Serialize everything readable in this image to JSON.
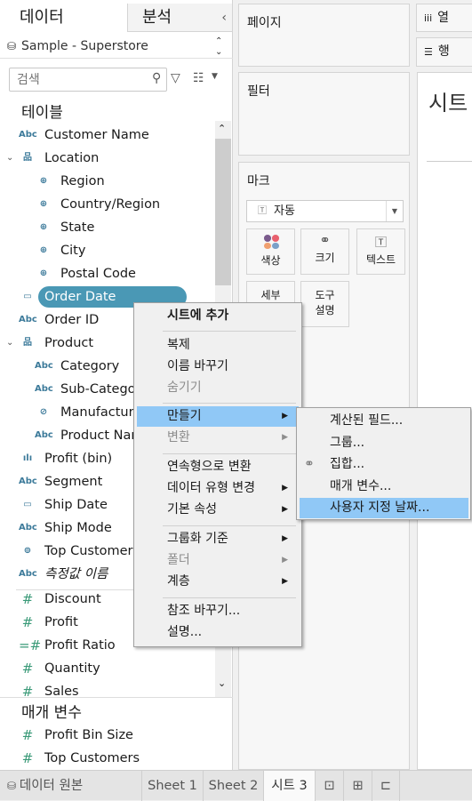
{
  "data_pane": {
    "tab_data": "데이터",
    "tab_analysis": "분석",
    "collapse_icon": "chevron-left-icon",
    "datasource": "Sample - Superstore",
    "search_placeholder": "검색",
    "tables_header": "테이블",
    "fields": [
      {
        "label": "Customer Name",
        "icon": "Abc"
      },
      {
        "label": "Location",
        "icon": "hierarchy",
        "expanded": true
      },
      {
        "label": "Region",
        "icon": "globe"
      },
      {
        "label": "Country/Region",
        "icon": "globe"
      },
      {
        "label": "State",
        "icon": "globe"
      },
      {
        "label": "City",
        "icon": "globe"
      },
      {
        "label": "Postal Code",
        "icon": "globe"
      },
      {
        "label": "Order Date",
        "icon": "calendar",
        "selected": true
      },
      {
        "label": "Order ID",
        "icon": "Abc"
      },
      {
        "label": "Product",
        "icon": "hierarchy",
        "expanded": true
      },
      {
        "label": "Category",
        "icon": "Abc"
      },
      {
        "label": "Sub-Category",
        "icon": "Abc"
      },
      {
        "label": "Manufacturer",
        "icon": "paperclip"
      },
      {
        "label": "Product Name",
        "icon": "Abc"
      },
      {
        "label": "Profit (bin)",
        "icon": "histogram"
      },
      {
        "label": "Segment",
        "icon": "Abc"
      },
      {
        "label": "Ship Date",
        "icon": "calendar"
      },
      {
        "label": "Ship Mode",
        "icon": "Abc"
      },
      {
        "label": "Top Customers",
        "icon": "set"
      },
      {
        "label": "측정값 이름",
        "icon": "Abc"
      },
      {
        "label": "Discount",
        "icon": "#"
      },
      {
        "label": "Profit",
        "icon": "#"
      },
      {
        "label": "Profit Ratio",
        "icon": "=#"
      },
      {
        "label": "Quantity",
        "icon": "#"
      },
      {
        "label": "Sales",
        "icon": "#"
      }
    ],
    "parameters_header": "매개 변수",
    "parameters": [
      {
        "label": "Profit Bin Size",
        "icon": "#"
      },
      {
        "label": "Top Customers",
        "icon": "#"
      }
    ]
  },
  "shelves": {
    "pages": "페이지",
    "filters": "필터",
    "marks": "마크",
    "mark_type": "자동",
    "mark_cards": [
      "색상",
      "크기",
      "텍스트",
      "세부",
      "도구 설명"
    ],
    "columns": "열",
    "rows": "행"
  },
  "sheet_title": "시트",
  "context_menu": {
    "items": [
      "시트에 추가",
      "복제",
      "이름 바꾸기",
      "숨기기",
      "만들기",
      "변환",
      "연속형으로 변환",
      "데이터 유형 변경",
      "기본 속성",
      "그룹화 기준",
      "폴더",
      "계층",
      "참조 바꾸기...",
      "설명..."
    ]
  },
  "submenu": {
    "items": [
      "계산된 필드...",
      "그룹...",
      "집합...",
      "매개 변수...",
      "사용자 지정 날짜..."
    ]
  },
  "bottom_tabs": {
    "datasource": "데이터 원본",
    "sheets": [
      "Sheet 1",
      "Sheet 2",
      "시트 3"
    ]
  },
  "colors": {
    "selected_field": "#4a98b5",
    "menu_highlight": "#90c8f6",
    "dimension_icon": "#3c7a9a",
    "measure_icon": "#3a9a78"
  }
}
